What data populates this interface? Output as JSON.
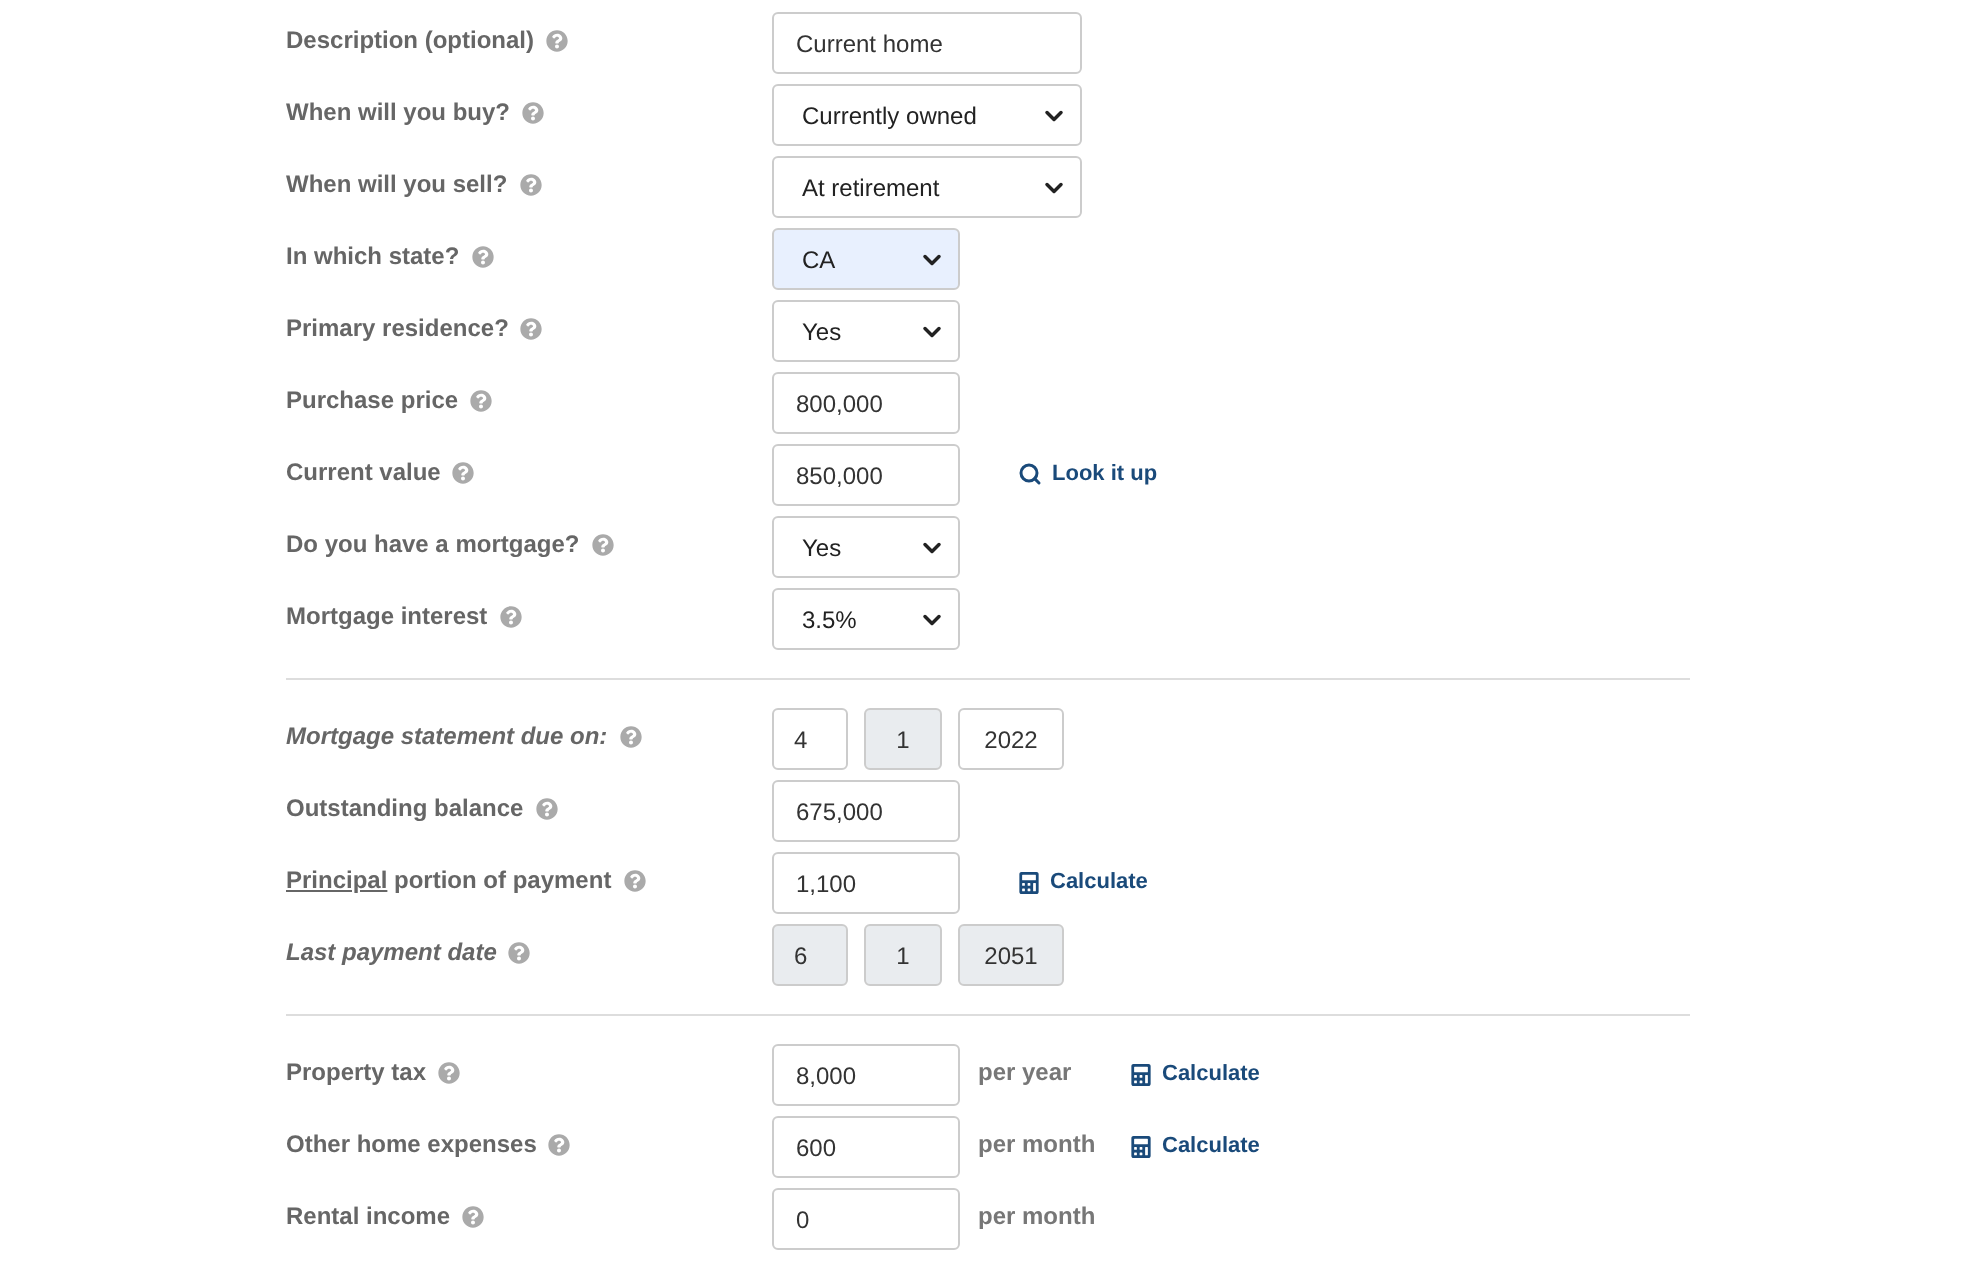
{
  "sections": [
    {
      "rows": [
        {
          "label": "Description (optional)",
          "kind": "text-wide",
          "value": "Current home"
        },
        {
          "label": "When will you buy?",
          "kind": "select-wide",
          "value": "Currently owned"
        },
        {
          "label": "When will you sell?",
          "kind": "select-wide",
          "value": "At retirement"
        },
        {
          "label": "In which state?",
          "kind": "select",
          "value": "CA",
          "highlighted": true
        },
        {
          "label": "Primary residence?",
          "kind": "select",
          "value": "Yes",
          "highlighted": false
        },
        {
          "label": "Purchase price",
          "kind": "text",
          "value": "800,000"
        },
        {
          "label": "Current value",
          "kind": "text",
          "value": "850,000",
          "action": {
            "kind": "search",
            "label": "Look it up"
          }
        },
        {
          "label": "Do you have a mortgage?",
          "kind": "select",
          "value": "Yes",
          "highlighted": false
        },
        {
          "label": "Mortgage interest",
          "kind": "select",
          "value": "3.5%",
          "highlighted": false
        }
      ]
    },
    {
      "rows": [
        {
          "label": "Mortgage statement due on:",
          "italic": true,
          "kind": "date",
          "parts": [
            {
              "value": "4",
              "disabled": false
            },
            {
              "value": "1",
              "disabled": true
            },
            {
              "value": "2022",
              "disabled": false
            }
          ]
        },
        {
          "label": "Outstanding balance",
          "kind": "text",
          "value": "675,000"
        },
        {
          "label_link": "Principal",
          "label": " portion of payment",
          "kind": "text",
          "value": "1,100",
          "action": {
            "kind": "calculator",
            "label": "Calculate"
          }
        },
        {
          "label": "Last payment date",
          "italic": true,
          "kind": "date",
          "parts": [
            {
              "value": "6",
              "disabled": true
            },
            {
              "value": "1",
              "disabled": true
            },
            {
              "value": "2051",
              "disabled": true
            }
          ]
        }
      ]
    },
    {
      "rows": [
        {
          "label": "Property tax",
          "kind": "text",
          "value": "8,000",
          "unit": "per year",
          "action": {
            "kind": "calculator",
            "label": "Calculate"
          }
        },
        {
          "label": "Other home expenses",
          "kind": "text",
          "value": "600",
          "unit": "per month",
          "action": {
            "kind": "calculator",
            "label": "Calculate"
          }
        },
        {
          "label": "Rental income",
          "kind": "text",
          "value": "0",
          "unit": "per month"
        }
      ]
    }
  ]
}
